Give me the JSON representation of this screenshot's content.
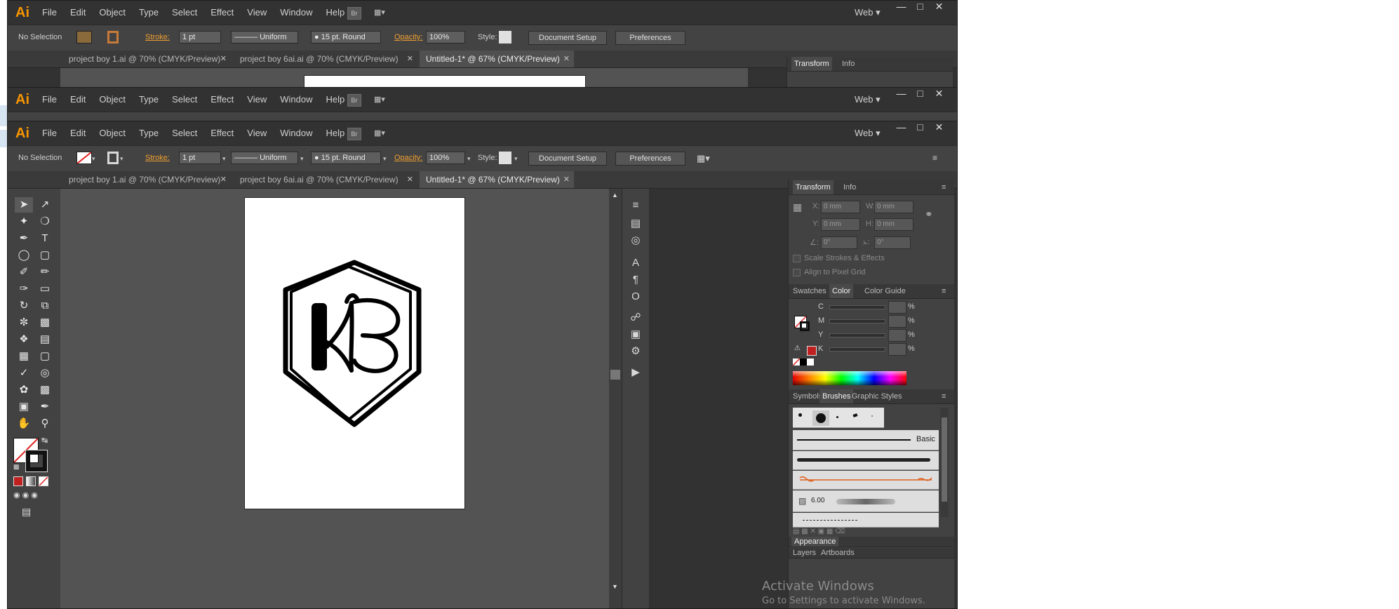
{
  "app": {
    "logo": "Ai",
    "menus": [
      "File",
      "Edit",
      "Object",
      "Type",
      "Select",
      "Effect",
      "View",
      "Window",
      "Help"
    ],
    "bridge": "Br",
    "workspace": "Web",
    "window_controls": [
      "—",
      "□",
      "✕"
    ]
  },
  "control": {
    "selection": "No Selection",
    "stroke_label": "Stroke:",
    "stroke_weight": "1 pt",
    "profile": "Uniform",
    "brush": "15 pt. Round",
    "opacity_label": "Opacity:",
    "opacity": "100%",
    "style_label": "Style:",
    "document_setup": "Document Setup",
    "preferences": "Preferences"
  },
  "tabs": [
    {
      "label": "project boy 1.ai @ 70% (CMYK/Preview)",
      "close": "✕"
    },
    {
      "label": "project boy 6ai.ai @ 70% (CMYK/Preview)",
      "close": "✕"
    },
    {
      "label": "Untitled-1* @ 67% (CMYK/Preview)",
      "close": "✕"
    }
  ],
  "transform": {
    "tabs": [
      "Transform",
      "Info"
    ],
    "x_label": "X:",
    "y_label": "Y:",
    "w_label": "W:",
    "h_label": "H:",
    "x": "0 mm",
    "y": "0 mm",
    "w": "0 mm",
    "h": "0 mm",
    "angle": "0°",
    "shear": "0°",
    "scale_strokes": "Scale Strokes & Effects",
    "align_pixel": "Align to Pixel Grid"
  },
  "color_panel": {
    "tabs": [
      "Swatches",
      "Color",
      "Color Guide"
    ],
    "channels": [
      "C",
      "M",
      "Y",
      "K"
    ],
    "unit": "%"
  },
  "brushes_panel": {
    "tabs": [
      "Symbols",
      "Brushes",
      "Graphic Styles"
    ],
    "basic_label": "Basic",
    "size_value": "6.00"
  },
  "appearance_panel": {
    "title": "Appearance",
    "layers_tabs": [
      "Layers",
      "Artboards"
    ]
  },
  "watermark": {
    "title": "Activate Windows",
    "subtitle": "Go to Settings to activate Windows."
  },
  "colors": {
    "accent": "#f79500",
    "ui_dark": "#323232",
    "canvas": "#535353",
    "artboard": "#ffffff",
    "stroke_red": "#e02020"
  }
}
